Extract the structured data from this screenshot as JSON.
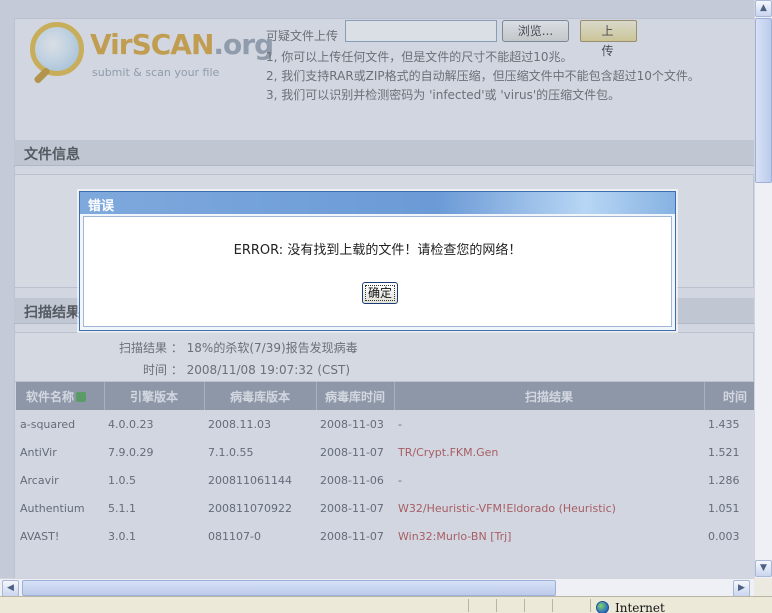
{
  "header": {
    "logo": {
      "brand_main": "VirSCAN",
      "brand_suffix": ".org",
      "slogan": "submit & scan your file"
    },
    "upload": {
      "label": "可疑文件上传",
      "browse_label": "浏览...",
      "submit_label": "上 传"
    },
    "rules": [
      "1, 你可以上传任何文件，但是文件的尺寸不能超过10兆。",
      "2, 我们支持RAR或ZIP格式的自动解压缩，但压缩文件中不能包含超过10个文件。",
      "3, 我们可以识别并检测密码为 'infected'或 'virus'的压缩文件包。"
    ]
  },
  "file_info": {
    "title": "文件信息"
  },
  "scan": {
    "title": "扫描结果",
    "summary": {
      "result_label": "扫描结果",
      "result_value": "18%的杀软(7/39)报告发现病毒",
      "time_label": "时间",
      "time_value": "2008/11/08 19:07:32 (CST)"
    },
    "columns": [
      "软件名称",
      "引擎版本",
      "病毒库版本",
      "病毒库时间",
      "扫描结果",
      "时间"
    ],
    "rows": [
      {
        "name": "a-squared",
        "engine": "4.0.0.23",
        "db": "2008.11.03",
        "db_time": "2008-11-03",
        "result": "-",
        "time": "1.435",
        "detected": false
      },
      {
        "name": "AntiVir",
        "engine": "7.9.0.29",
        "db": "7.1.0.55",
        "db_time": "2008-11-07",
        "result": "TR/Crypt.FKM.Gen",
        "time": "1.521",
        "detected": true
      },
      {
        "name": "Arcavir",
        "engine": "1.0.5",
        "db": "200811061144",
        "db_time": "2008-11-06",
        "result": "-",
        "time": "1.286",
        "detected": false
      },
      {
        "name": "Authentium",
        "engine": "5.1.1",
        "db": "200811070922",
        "db_time": "2008-11-07",
        "result": "W32/Heuristic-VFM!Eldorado (Heuristic)",
        "time": "1.051",
        "detected": true
      },
      {
        "name": "AVAST!",
        "engine": "3.0.1",
        "db": "081107-0",
        "db_time": "2008-11-07",
        "result": "Win32:Murlo-BN [Trj]",
        "time": "0.003",
        "detected": true
      }
    ]
  },
  "dialog": {
    "title": "错误",
    "message": "ERROR: 没有找到上载的文件！请检查您的网络！",
    "ok_label": "确定"
  },
  "statusbar": {
    "zone": "Internet"
  }
}
